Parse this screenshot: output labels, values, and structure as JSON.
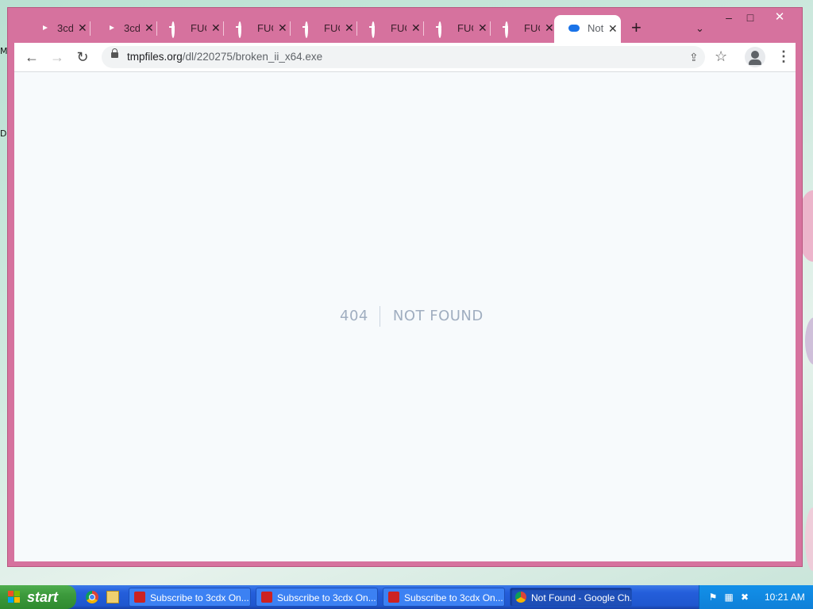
{
  "desktop": {
    "left_text": "M\n\nD"
  },
  "browser": {
    "tabs": [
      {
        "title": "3cd",
        "icon": "youtube-icon"
      },
      {
        "title": "3cd",
        "icon": "youtube-icon"
      },
      {
        "title": "FUC",
        "icon": "google-icon"
      },
      {
        "title": "FUC",
        "icon": "google-icon"
      },
      {
        "title": "FUC",
        "icon": "google-icon"
      },
      {
        "title": "FUC",
        "icon": "google-icon"
      },
      {
        "title": "FUC",
        "icon": "google-icon"
      },
      {
        "title": "FUC",
        "icon": "google-icon"
      },
      {
        "title": "Not",
        "icon": "cloud-upload-icon",
        "active": true
      }
    ],
    "new_tab": "+",
    "tab_search": "⌄",
    "window_controls": {
      "minimize": "–",
      "maximize": "□",
      "close": "✕"
    },
    "toolbar": {
      "back": "←",
      "forward": "→",
      "reload": "↻",
      "url_host": "tmpfiles.org",
      "url_path": "/dl/220275/broken_ii_x64.exe",
      "share": "⇪",
      "bookmark": "☆",
      "menu": "⋮"
    },
    "page": {
      "code": "404",
      "message": "NOT FOUND"
    }
  },
  "taskbar": {
    "start_label": "start",
    "tasks": [
      {
        "label": "Subscribe to 3cdx On...",
        "active": false
      },
      {
        "label": "Subscribe to 3cdx On...",
        "active": false
      },
      {
        "label": "Subscribe to 3cdx On...",
        "active": false
      },
      {
        "label": "Not Found - Google Ch...",
        "active": true
      }
    ],
    "clock": "10:21 AM"
  }
}
